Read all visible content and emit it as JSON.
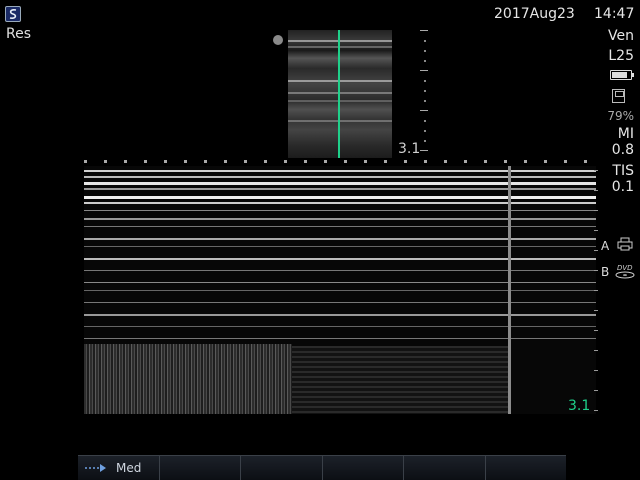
{
  "header": {
    "logo": "s-logo-icon",
    "mode_label": "Res",
    "date": "2017Aug23",
    "time": "14:47"
  },
  "right_panel": {
    "exam_type": "Ven",
    "transducer": "L25",
    "battery_level": 0.85,
    "storage_icon": "floppy-disk-icon",
    "storage_percent": "79%",
    "mi_label": "MI",
    "mi_value": "0.8",
    "tis_label": "TIS",
    "tis_value": "0.1",
    "channel_a_label": "A",
    "channel_a_icon": "printer-icon",
    "channel_b_label": "B",
    "channel_b_icon": "dvd-icon",
    "channel_b_icon_text": "DVD"
  },
  "bmode": {
    "depth": "3.1"
  },
  "mmode": {
    "depth": "3.1"
  },
  "softkeys": [
    {
      "icon": "arrow-right-icon",
      "label": "Med"
    },
    {
      "label": ""
    },
    {
      "label": ""
    },
    {
      "label": ""
    },
    {
      "label": ""
    },
    {
      "label": ""
    }
  ],
  "colors": {
    "cursor_line": "#1fd08a",
    "background": "#000000",
    "softkey_bar": "#12161d"
  }
}
